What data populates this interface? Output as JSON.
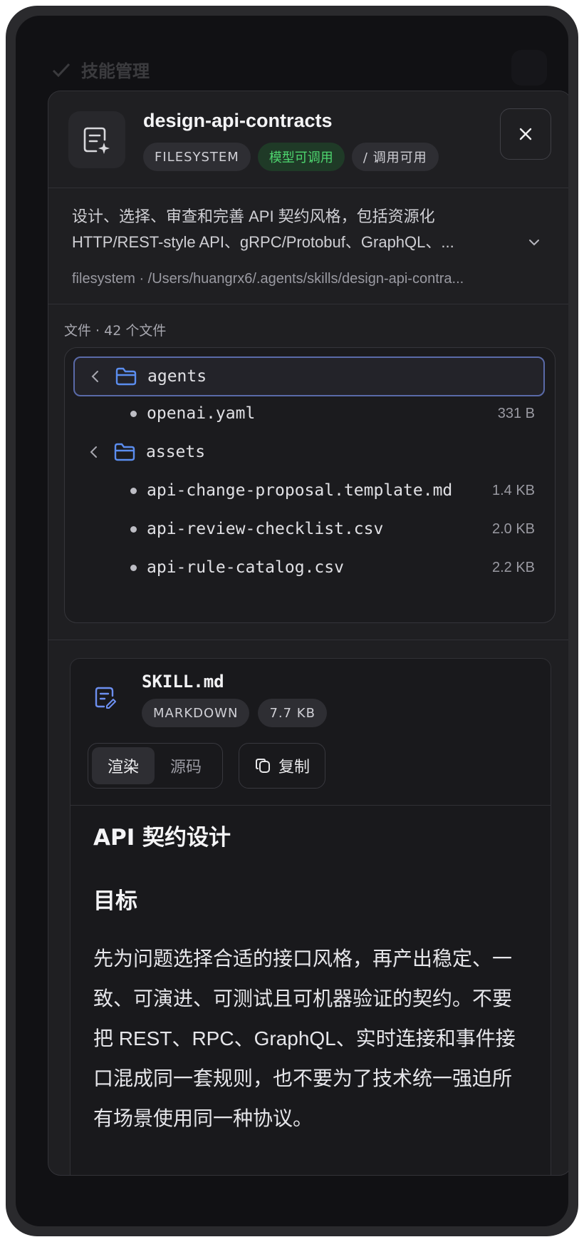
{
  "background": {
    "title": "技能管理"
  },
  "modal": {
    "title": "design-api-contracts",
    "tags": [
      "FILESYSTEM",
      "模型可调用",
      "/ 调用可用"
    ],
    "description_lines": [
      "设计、选择、审查和完善 API 契约风格，包括资源化",
      "HTTP/REST-style API、gRPC/Protobuf、GraphQL、..."
    ],
    "path": "filesystem · /Users/huangrx6/.agents/skills/design-api-contra..."
  },
  "files": {
    "label": "文件 · 42 个文件",
    "rows": [
      {
        "kind": "folder",
        "name": "agents",
        "size": ""
      },
      {
        "kind": "file",
        "name": "openai.yaml",
        "size": "331 B"
      },
      {
        "kind": "folder",
        "name": "assets",
        "size": ""
      },
      {
        "kind": "file",
        "name": "api-change-proposal.template.md",
        "size": "1.4 KB"
      },
      {
        "kind": "file",
        "name": "api-review-checklist.csv",
        "size": "2.0 KB"
      },
      {
        "kind": "file",
        "name": "api-rule-catalog.csv",
        "size": "2.2 KB"
      }
    ]
  },
  "preview": {
    "filename": "SKILL.md",
    "tags": [
      "MARKDOWN",
      "7.7 KB"
    ],
    "modes": [
      "渲染",
      "源码"
    ],
    "copy_label": "复制",
    "h1": "API 契约设计",
    "h2": "目标",
    "paragraph": "先为问题选择合适的接口风格，再产出稳定、一致、可演进、可测试且可机器验证的契约。不要把 REST、RPC、GraphQL、实时连接和事件接口混成同一套规则，也不要为了技术统一强迫所有场景使用同一种协议。"
  },
  "colors": {
    "accent_blue": "#5b8def",
    "success_green": "#4ed66f"
  }
}
